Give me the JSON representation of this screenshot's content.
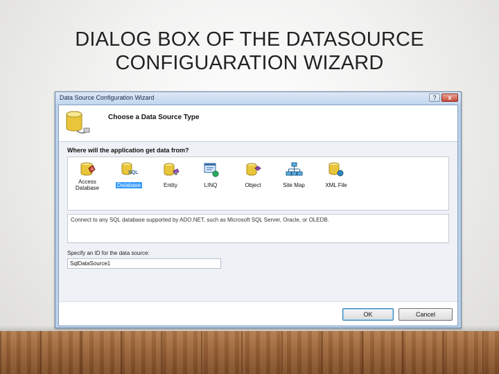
{
  "slide": {
    "title_line1": "DIALOG BOX OF THE DATASOURCE",
    "title_line2": "CONFIGUARATION WIZARD"
  },
  "dialog": {
    "window_title": "Data Source Configuration Wizard",
    "window_buttons": {
      "help": "?",
      "close": "x"
    },
    "header_title": "Choose a Data Source Type",
    "question": "Where will the application get data from?",
    "data_source_types": [
      {
        "label": "Access Database",
        "icon": "access-database-icon",
        "selected": false
      },
      {
        "label": "Database",
        "icon": "sql-database-icon",
        "selected": true
      },
      {
        "label": "Entity",
        "icon": "entity-icon",
        "selected": false
      },
      {
        "label": "LINQ",
        "icon": "linq-icon",
        "selected": false
      },
      {
        "label": "Object",
        "icon": "object-icon",
        "selected": false
      },
      {
        "label": "Site Map",
        "icon": "site-map-icon",
        "selected": false
      },
      {
        "label": "XML File",
        "icon": "xml-file-icon",
        "selected": false
      }
    ],
    "description": "Connect to any SQL database supported by ADO.NET, such as Microsoft SQL Server, Oracle, or OLEDB.",
    "id_label": "Specify an ID for the data source:",
    "id_value": "SqlDataSource1",
    "ok_label": "OK",
    "cancel_label": "Cancel"
  },
  "colors": {
    "selection": "#3399ff",
    "dialog_frame": "#b9d1ea",
    "database_yellow": "#e8c53a"
  }
}
